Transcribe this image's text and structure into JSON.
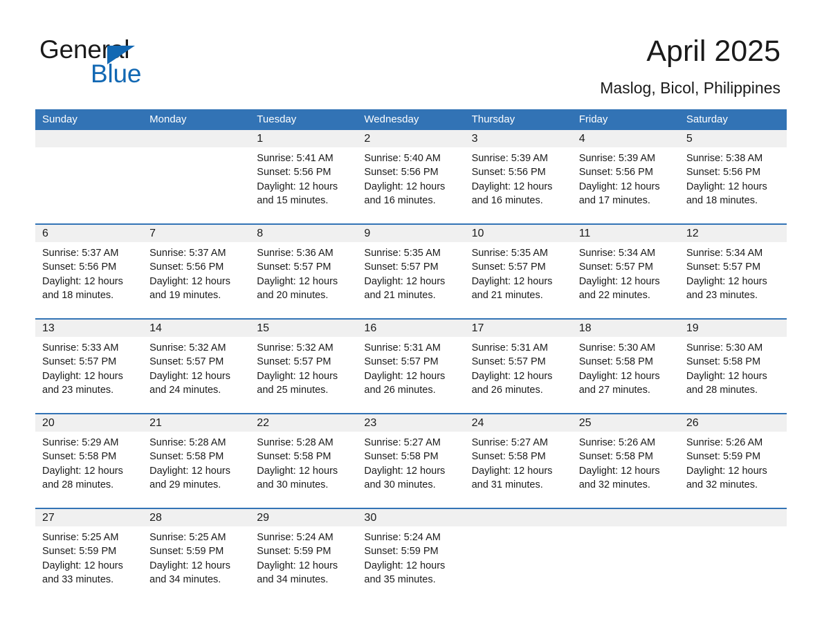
{
  "brand": {
    "name_part1": "General",
    "name_part2": "Blue",
    "logo_icon": "triangle-flag-icon",
    "accent_color": "#1268b3"
  },
  "header": {
    "title": "April 2025",
    "location": "Maslog, Bicol, Philippines",
    "header_bg_color": "#3273b5",
    "daynum_bg_color": "#f0f0f0"
  },
  "calendar": {
    "weekday_headers": [
      "Sunday",
      "Monday",
      "Tuesday",
      "Wednesday",
      "Thursday",
      "Friday",
      "Saturday"
    ],
    "weeks": [
      {
        "days": [
          {
            "num": "",
            "sunrise": "",
            "sunset": "",
            "daylight_line1": "",
            "daylight_line2": ""
          },
          {
            "num": "",
            "sunrise": "",
            "sunset": "",
            "daylight_line1": "",
            "daylight_line2": ""
          },
          {
            "num": "1",
            "sunrise": "Sunrise: 5:41 AM",
            "sunset": "Sunset: 5:56 PM",
            "daylight_line1": "Daylight: 12 hours",
            "daylight_line2": "and 15 minutes."
          },
          {
            "num": "2",
            "sunrise": "Sunrise: 5:40 AM",
            "sunset": "Sunset: 5:56 PM",
            "daylight_line1": "Daylight: 12 hours",
            "daylight_line2": "and 16 minutes."
          },
          {
            "num": "3",
            "sunrise": "Sunrise: 5:39 AM",
            "sunset": "Sunset: 5:56 PM",
            "daylight_line1": "Daylight: 12 hours",
            "daylight_line2": "and 16 minutes."
          },
          {
            "num": "4",
            "sunrise": "Sunrise: 5:39 AM",
            "sunset": "Sunset: 5:56 PM",
            "daylight_line1": "Daylight: 12 hours",
            "daylight_line2": "and 17 minutes."
          },
          {
            "num": "5",
            "sunrise": "Sunrise: 5:38 AM",
            "sunset": "Sunset: 5:56 PM",
            "daylight_line1": "Daylight: 12 hours",
            "daylight_line2": "and 18 minutes."
          }
        ]
      },
      {
        "days": [
          {
            "num": "6",
            "sunrise": "Sunrise: 5:37 AM",
            "sunset": "Sunset: 5:56 PM",
            "daylight_line1": "Daylight: 12 hours",
            "daylight_line2": "and 18 minutes."
          },
          {
            "num": "7",
            "sunrise": "Sunrise: 5:37 AM",
            "sunset": "Sunset: 5:56 PM",
            "daylight_line1": "Daylight: 12 hours",
            "daylight_line2": "and 19 minutes."
          },
          {
            "num": "8",
            "sunrise": "Sunrise: 5:36 AM",
            "sunset": "Sunset: 5:57 PM",
            "daylight_line1": "Daylight: 12 hours",
            "daylight_line2": "and 20 minutes."
          },
          {
            "num": "9",
            "sunrise": "Sunrise: 5:35 AM",
            "sunset": "Sunset: 5:57 PM",
            "daylight_line1": "Daylight: 12 hours",
            "daylight_line2": "and 21 minutes."
          },
          {
            "num": "10",
            "sunrise": "Sunrise: 5:35 AM",
            "sunset": "Sunset: 5:57 PM",
            "daylight_line1": "Daylight: 12 hours",
            "daylight_line2": "and 21 minutes."
          },
          {
            "num": "11",
            "sunrise": "Sunrise: 5:34 AM",
            "sunset": "Sunset: 5:57 PM",
            "daylight_line1": "Daylight: 12 hours",
            "daylight_line2": "and 22 minutes."
          },
          {
            "num": "12",
            "sunrise": "Sunrise: 5:34 AM",
            "sunset": "Sunset: 5:57 PM",
            "daylight_line1": "Daylight: 12 hours",
            "daylight_line2": "and 23 minutes."
          }
        ]
      },
      {
        "days": [
          {
            "num": "13",
            "sunrise": "Sunrise: 5:33 AM",
            "sunset": "Sunset: 5:57 PM",
            "daylight_line1": "Daylight: 12 hours",
            "daylight_line2": "and 23 minutes."
          },
          {
            "num": "14",
            "sunrise": "Sunrise: 5:32 AM",
            "sunset": "Sunset: 5:57 PM",
            "daylight_line1": "Daylight: 12 hours",
            "daylight_line2": "and 24 minutes."
          },
          {
            "num": "15",
            "sunrise": "Sunrise: 5:32 AM",
            "sunset": "Sunset: 5:57 PM",
            "daylight_line1": "Daylight: 12 hours",
            "daylight_line2": "and 25 minutes."
          },
          {
            "num": "16",
            "sunrise": "Sunrise: 5:31 AM",
            "sunset": "Sunset: 5:57 PM",
            "daylight_line1": "Daylight: 12 hours",
            "daylight_line2": "and 26 minutes."
          },
          {
            "num": "17",
            "sunrise": "Sunrise: 5:31 AM",
            "sunset": "Sunset: 5:57 PM",
            "daylight_line1": "Daylight: 12 hours",
            "daylight_line2": "and 26 minutes."
          },
          {
            "num": "18",
            "sunrise": "Sunrise: 5:30 AM",
            "sunset": "Sunset: 5:58 PM",
            "daylight_line1": "Daylight: 12 hours",
            "daylight_line2": "and 27 minutes."
          },
          {
            "num": "19",
            "sunrise": "Sunrise: 5:30 AM",
            "sunset": "Sunset: 5:58 PM",
            "daylight_line1": "Daylight: 12 hours",
            "daylight_line2": "and 28 minutes."
          }
        ]
      },
      {
        "days": [
          {
            "num": "20",
            "sunrise": "Sunrise: 5:29 AM",
            "sunset": "Sunset: 5:58 PM",
            "daylight_line1": "Daylight: 12 hours",
            "daylight_line2": "and 28 minutes."
          },
          {
            "num": "21",
            "sunrise": "Sunrise: 5:28 AM",
            "sunset": "Sunset: 5:58 PM",
            "daylight_line1": "Daylight: 12 hours",
            "daylight_line2": "and 29 minutes."
          },
          {
            "num": "22",
            "sunrise": "Sunrise: 5:28 AM",
            "sunset": "Sunset: 5:58 PM",
            "daylight_line1": "Daylight: 12 hours",
            "daylight_line2": "and 30 minutes."
          },
          {
            "num": "23",
            "sunrise": "Sunrise: 5:27 AM",
            "sunset": "Sunset: 5:58 PM",
            "daylight_line1": "Daylight: 12 hours",
            "daylight_line2": "and 30 minutes."
          },
          {
            "num": "24",
            "sunrise": "Sunrise: 5:27 AM",
            "sunset": "Sunset: 5:58 PM",
            "daylight_line1": "Daylight: 12 hours",
            "daylight_line2": "and 31 minutes."
          },
          {
            "num": "25",
            "sunrise": "Sunrise: 5:26 AM",
            "sunset": "Sunset: 5:58 PM",
            "daylight_line1": "Daylight: 12 hours",
            "daylight_line2": "and 32 minutes."
          },
          {
            "num": "26",
            "sunrise": "Sunrise: 5:26 AM",
            "sunset": "Sunset: 5:59 PM",
            "daylight_line1": "Daylight: 12 hours",
            "daylight_line2": "and 32 minutes."
          }
        ]
      },
      {
        "days": [
          {
            "num": "27",
            "sunrise": "Sunrise: 5:25 AM",
            "sunset": "Sunset: 5:59 PM",
            "daylight_line1": "Daylight: 12 hours",
            "daylight_line2": "and 33 minutes."
          },
          {
            "num": "28",
            "sunrise": "Sunrise: 5:25 AM",
            "sunset": "Sunset: 5:59 PM",
            "daylight_line1": "Daylight: 12 hours",
            "daylight_line2": "and 34 minutes."
          },
          {
            "num": "29",
            "sunrise": "Sunrise: 5:24 AM",
            "sunset": "Sunset: 5:59 PM",
            "daylight_line1": "Daylight: 12 hours",
            "daylight_line2": "and 34 minutes."
          },
          {
            "num": "30",
            "sunrise": "Sunrise: 5:24 AM",
            "sunset": "Sunset: 5:59 PM",
            "daylight_line1": "Daylight: 12 hours",
            "daylight_line2": "and 35 minutes."
          },
          {
            "num": "",
            "sunrise": "",
            "sunset": "",
            "daylight_line1": "",
            "daylight_line2": ""
          },
          {
            "num": "",
            "sunrise": "",
            "sunset": "",
            "daylight_line1": "",
            "daylight_line2": ""
          },
          {
            "num": "",
            "sunrise": "",
            "sunset": "",
            "daylight_line1": "",
            "daylight_line2": ""
          }
        ]
      }
    ]
  }
}
